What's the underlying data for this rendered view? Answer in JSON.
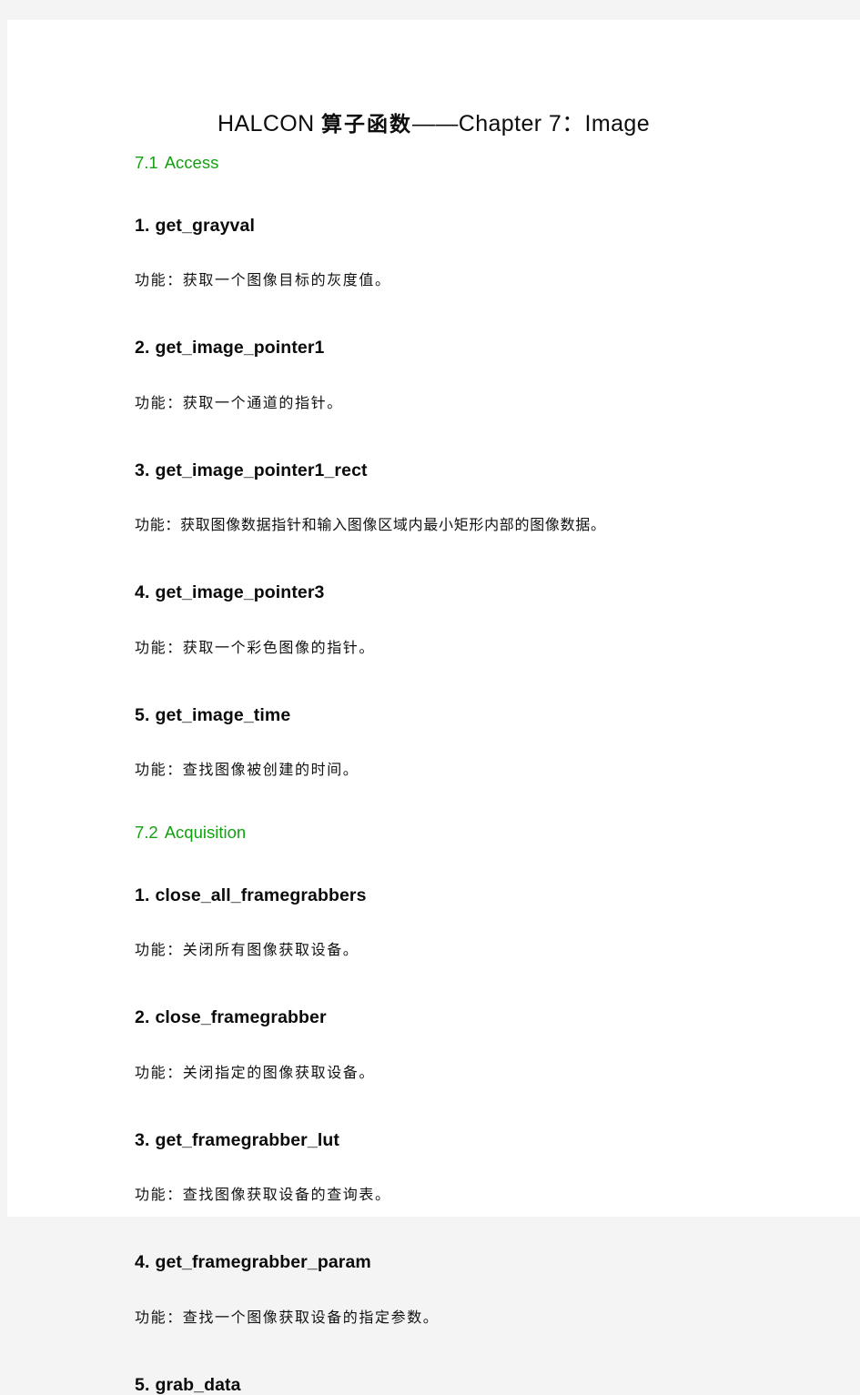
{
  "document": {
    "title_latin_1": "HALCON",
    "title_cjk": "算子函数",
    "title_latin_2": "——Chapter 7：Image",
    "title_full": "HALCON 算子函数——Chapter 7：Image"
  },
  "theme": {
    "heading_green": "#13a112",
    "body_black": "#111111",
    "page_background": "#ffffff",
    "scan_margin": "#f4f4f5"
  },
  "sections": [
    {
      "number": "7.1",
      "name": "Access",
      "entries": [
        {
          "index": "1.",
          "operator": "get_grayval",
          "description": "功能：获取一个图像目标的灰度值。"
        },
        {
          "index": "2.",
          "operator": "get_image_pointer1",
          "description": "功能：获取一个通道的指针。"
        },
        {
          "index": "3.",
          "operator": "get_image_pointer1_rect",
          "description": "功能：获取图像数据指针和输入图像区域内最小矩形内部的图像数据。"
        },
        {
          "index": "4.",
          "operator": "get_image_pointer3",
          "description": "功能：获取一个彩色图像的指针。"
        },
        {
          "index": "5.",
          "operator": "get_image_time",
          "description": "功能：查找图像被创建的时间。"
        }
      ]
    },
    {
      "number": "7.2",
      "name": "Acquisition",
      "entries": [
        {
          "index": "1.",
          "operator": "close_all_framegrabbers",
          "description": "功能：关闭所有图像获取设备。"
        },
        {
          "index": "2.",
          "operator": "close_framegrabber",
          "description": "功能：关闭指定的图像获取设备。"
        },
        {
          "index": "3.",
          "operator": "get_framegrabber_lut",
          "description": "功能：查找图像获取设备的查询表。"
        },
        {
          "index": "4.",
          "operator": "get_framegrabber_param",
          "description": "功能：查找一个图像获取设备的指定参数。"
        },
        {
          "index": "5.",
          "operator": "grab_data",
          "description": ""
        }
      ]
    }
  ]
}
